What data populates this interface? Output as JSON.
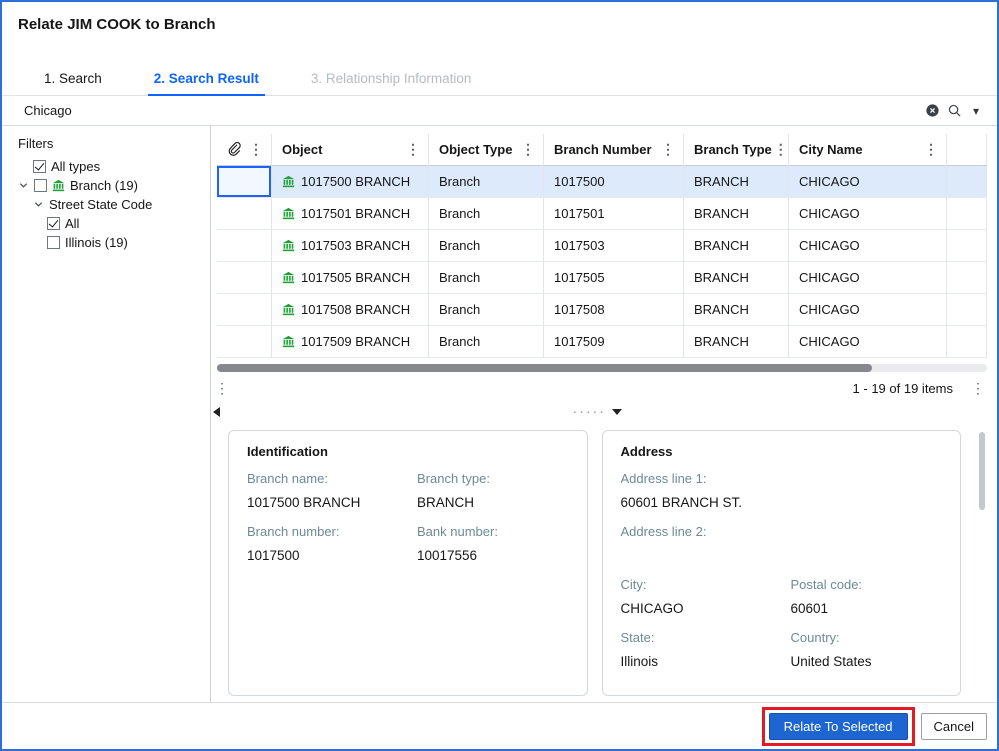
{
  "colors": {
    "accent_blue": "#0f62fe",
    "dialog_border": "#2e6fd6",
    "selected_row_bg": "#dceafb",
    "branch_icon_green": "#21a038",
    "annotation_red": "#e01b24",
    "field_label_gray": "#6d8a98"
  },
  "icons": {
    "clear": "circle-x",
    "search": "magnifier",
    "dropdown": "caret-down",
    "kebab": "vertical-ellipsis",
    "attachment": "paperclip",
    "branch": "bank-building",
    "tree_expand": "chevron-down",
    "splitter_collapse": "triangle-left",
    "splitter_resize": "grip-dots",
    "splitter_down": "triangle-down"
  },
  "dialog": {
    "title": "Relate JIM COOK to Branch"
  },
  "tabs": [
    {
      "label": "1. Search"
    },
    {
      "label": "2. Search Result"
    },
    {
      "label": "3. Relationship Information"
    }
  ],
  "search": {
    "value": "Chicago"
  },
  "filters": {
    "heading": "Filters",
    "all_types": "All types",
    "branch": "Branch (19)",
    "street_state_code": "Street State Code",
    "all": "All",
    "illinois": "Illinois (19)"
  },
  "table": {
    "columns": {
      "object": "Object",
      "object_type": "Object Type",
      "branch_number": "Branch Number",
      "branch_type": "Branch Type",
      "city_name": "City Name"
    },
    "rows": [
      {
        "object": "1017500 BRANCH",
        "object_type": "Branch",
        "branch_number": "1017500",
        "branch_type": "BRANCH",
        "city_name": "CHICAGO"
      },
      {
        "object": "1017501 BRANCH",
        "object_type": "Branch",
        "branch_number": "1017501",
        "branch_type": "BRANCH",
        "city_name": "CHICAGO"
      },
      {
        "object": "1017503 BRANCH",
        "object_type": "Branch",
        "branch_number": "1017503",
        "branch_type": "BRANCH",
        "city_name": "CHICAGO"
      },
      {
        "object": "1017505 BRANCH",
        "object_type": "Branch",
        "branch_number": "1017505",
        "branch_type": "BRANCH",
        "city_name": "CHICAGO"
      },
      {
        "object": "1017508 BRANCH",
        "object_type": "Branch",
        "branch_number": "1017508",
        "branch_type": "BRANCH",
        "city_name": "CHICAGO"
      },
      {
        "object": "1017509 BRANCH",
        "object_type": "Branch",
        "branch_number": "1017509",
        "branch_type": "BRANCH",
        "city_name": "CHICAGO"
      }
    ],
    "pagination": "1 - 19 of 19 items"
  },
  "identification": {
    "title": "Identification",
    "branch_name_label": "Branch name:",
    "branch_name": "1017500 BRANCH",
    "branch_type_label": "Branch type:",
    "branch_type": "BRANCH",
    "branch_number_label": "Branch number:",
    "branch_number": "1017500",
    "bank_number_label": "Bank number:",
    "bank_number": "10017556"
  },
  "address": {
    "title": "Address",
    "line1_label": "Address line 1:",
    "line1": "60601 BRANCH ST.",
    "line2_label": "Address line 2:",
    "line2": "",
    "city_label": "City:",
    "city": "CHICAGO",
    "postal_label": "Postal code:",
    "postal": "60601",
    "state_label": "State:",
    "state": "Illinois",
    "country_label": "Country:",
    "country": "United States"
  },
  "footer": {
    "relate_label": "Relate To Selected",
    "cancel_label": "Cancel"
  }
}
